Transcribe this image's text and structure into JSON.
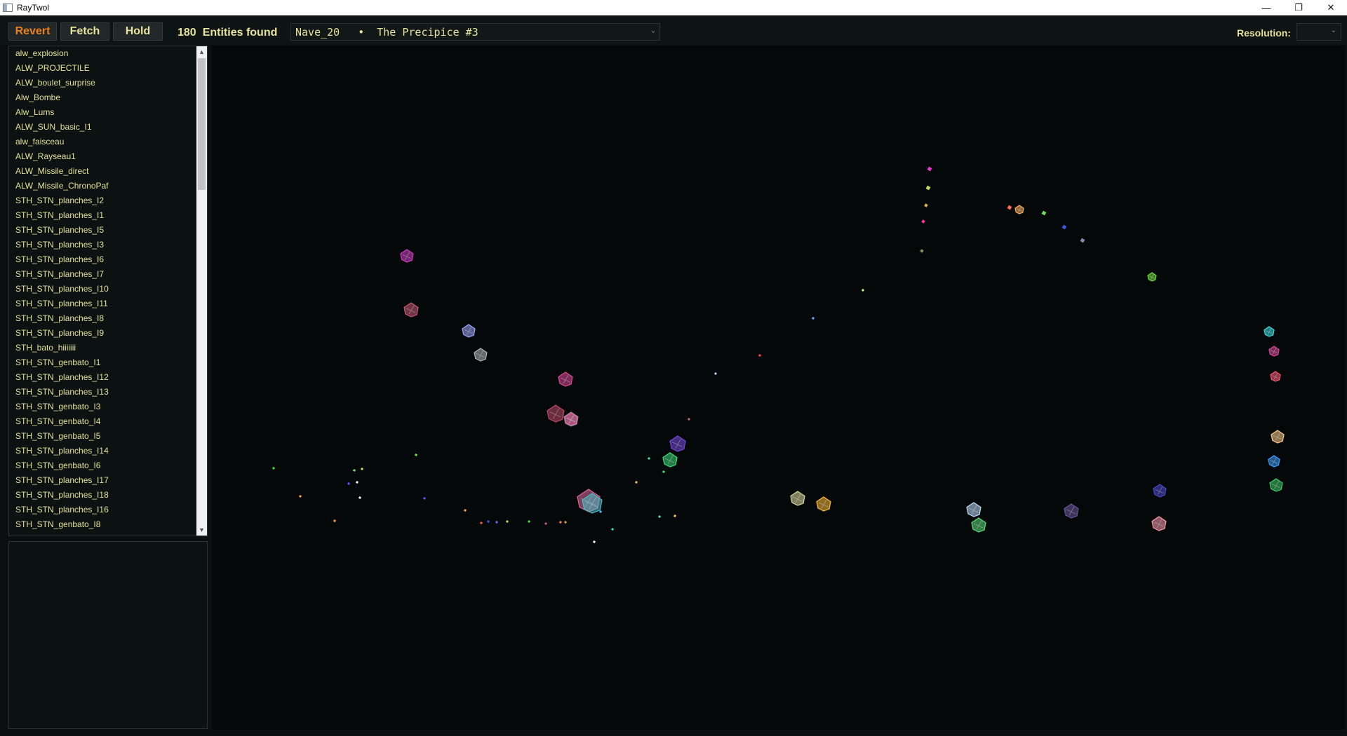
{
  "window": {
    "title": "RayTwol",
    "controls": {
      "minimize": "—",
      "restore": "❐",
      "close": "✕"
    }
  },
  "toolbar": {
    "revert_label": "Revert",
    "fetch_label": "Fetch",
    "hold_label": "Hold",
    "entity_count": "180",
    "entity_count_label": "Entities found",
    "level_code": "Nave_20",
    "level_separator": "•",
    "level_name": "The Precipice #3",
    "resolution_label": "Resolution:",
    "resolution_value": ""
  },
  "colors": {
    "accent_yellow": "#e7e29a",
    "accent_orange": "#e9821e",
    "background": "#0b0f0f"
  },
  "entities": [
    "alw_explosion",
    "ALW_PROJECTILE",
    "ALW_boulet_surprise",
    "Alw_Bombe",
    "Alw_Lums",
    "ALW_SUN_basic_I1",
    "alw_faisceau",
    "ALW_Rayseau1",
    "ALW_Missile_direct",
    "ALW_Missile_ChronoPaf",
    "STH_STN_planches_I2",
    "STH_STN_planches_I1",
    "STH_STN_planches_I5",
    "STH_STN_planches_I3",
    "STH_STN_planches_I6",
    "STH_STN_planches_I7",
    "STH_STN_planches_I10",
    "STH_STN_planches_I11",
    "STH_STN_planches_I8",
    "STH_STN_planches_I9",
    "STH_bato_hiiiiiii",
    "STH_STN_genbato_I1",
    "STH_STN_planches_I12",
    "STH_STN_planches_I13",
    "STH_STN_genbato_I3",
    "STH_STN_genbato_I4",
    "STH_STN_genbato_I5",
    "STH_STN_planches_I14",
    "STH_STN_genbato_I6",
    "STH_STN_planches_I17",
    "STH_STN_planches_I18",
    "STH_STN_planches_I16",
    "STH_STN_genbato_I8"
  ]
}
